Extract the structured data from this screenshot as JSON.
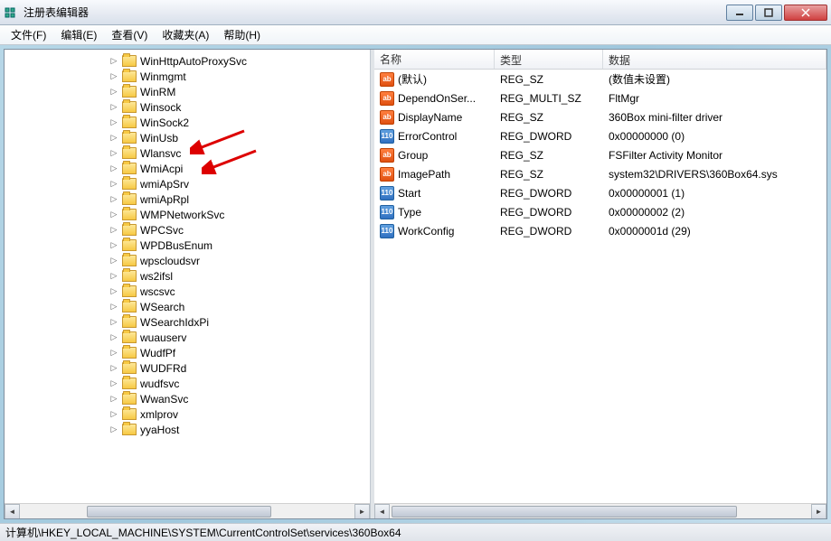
{
  "window": {
    "title": "注册表编辑器"
  },
  "menu": {
    "file": "文件(F)",
    "edit": "编辑(E)",
    "view": "查看(V)",
    "favorites": "收藏夹(A)",
    "help": "帮助(H)"
  },
  "tree": {
    "items": [
      {
        "label": "WinHttpAutoProxySvc"
      },
      {
        "label": "Winmgmt"
      },
      {
        "label": "WinRM"
      },
      {
        "label": "Winsock"
      },
      {
        "label": "WinSock2"
      },
      {
        "label": "WinUsb"
      },
      {
        "label": "Wlansvc"
      },
      {
        "label": "WmiAcpi"
      },
      {
        "label": "wmiApSrv"
      },
      {
        "label": "wmiApRpl"
      },
      {
        "label": "WMPNetworkSvc"
      },
      {
        "label": "WPCSvc"
      },
      {
        "label": "WPDBusEnum"
      },
      {
        "label": "wpscloudsvr"
      },
      {
        "label": "ws2ifsl"
      },
      {
        "label": "wscsvc"
      },
      {
        "label": "WSearch"
      },
      {
        "label": "WSearchIdxPi"
      },
      {
        "label": "wuauserv"
      },
      {
        "label": "WudfPf"
      },
      {
        "label": "WUDFRd"
      },
      {
        "label": "wudfsvc"
      },
      {
        "label": "WwanSvc"
      },
      {
        "label": "xmlprov"
      },
      {
        "label": "yyaHost"
      }
    ]
  },
  "list": {
    "headers": {
      "name": "名称",
      "type": "类型",
      "data": "数据"
    },
    "rows": [
      {
        "icon": "string",
        "name": "(默认)",
        "type": "REG_SZ",
        "data": "(数值未设置)"
      },
      {
        "icon": "string",
        "name": "DependOnSer...",
        "type": "REG_MULTI_SZ",
        "data": "FltMgr"
      },
      {
        "icon": "string",
        "name": "DisplayName",
        "type": "REG_SZ",
        "data": "360Box mini-filter driver"
      },
      {
        "icon": "binary",
        "name": "ErrorControl",
        "type": "REG_DWORD",
        "data": "0x00000000 (0)"
      },
      {
        "icon": "string",
        "name": "Group",
        "type": "REG_SZ",
        "data": "FSFilter Activity Monitor"
      },
      {
        "icon": "string",
        "name": "ImagePath",
        "type": "REG_SZ",
        "data": "system32\\DRIVERS\\360Box64.sys"
      },
      {
        "icon": "binary",
        "name": "Start",
        "type": "REG_DWORD",
        "data": "0x00000001 (1)"
      },
      {
        "icon": "binary",
        "name": "Type",
        "type": "REG_DWORD",
        "data": "0x00000002 (2)"
      },
      {
        "icon": "binary",
        "name": "WorkConfig",
        "type": "REG_DWORD",
        "data": "0x0000001d (29)"
      }
    ]
  },
  "statusbar": {
    "path": "计算机\\HKEY_LOCAL_MACHINE\\SYSTEM\\CurrentControlSet\\services\\360Box64"
  },
  "icons": {
    "string_label": "ab",
    "binary_label": "110"
  }
}
